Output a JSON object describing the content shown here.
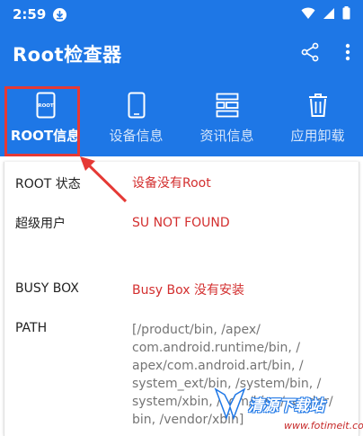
{
  "status_bar": {
    "time": "2:59"
  },
  "app_bar": {
    "title": "Root检查器",
    "share_icon": "share-icon",
    "menu_icon": "more-vert-icon"
  },
  "tabs": [
    {
      "label": "ROOT信息",
      "icon": "phone-root-icon",
      "active": true
    },
    {
      "label": "设备信息",
      "icon": "phone-icon",
      "active": false
    },
    {
      "label": "资讯信息",
      "icon": "info-layout-icon",
      "active": false
    },
    {
      "label": "应用卸载",
      "icon": "trash-icon",
      "active": false
    }
  ],
  "tab_icon_text": "ROOT",
  "rows": [
    {
      "key": "ROOT 状态",
      "value": "设备没有Root"
    },
    {
      "key": "超级用户",
      "value": "SU NOT FOUND"
    },
    {
      "key": "BUSY BOX",
      "value": "Busy Box 没有安装"
    },
    {
      "key": "PATH",
      "value": "[/product/bin, /apex/ com.android.runtime/bin, / apex/com.android.art/bin, / system_ext/bin, /system/bin, / system/xbin, /odm/bin, /vendor/ bin, /vendor/xbin]"
    }
  ],
  "watermark": {
    "text": "清源下载站",
    "url": "www.fotimeit.com"
  },
  "colors": {
    "primary": "#1e77e6",
    "value_red": "#d32f2f",
    "highlight": "#e53935"
  }
}
